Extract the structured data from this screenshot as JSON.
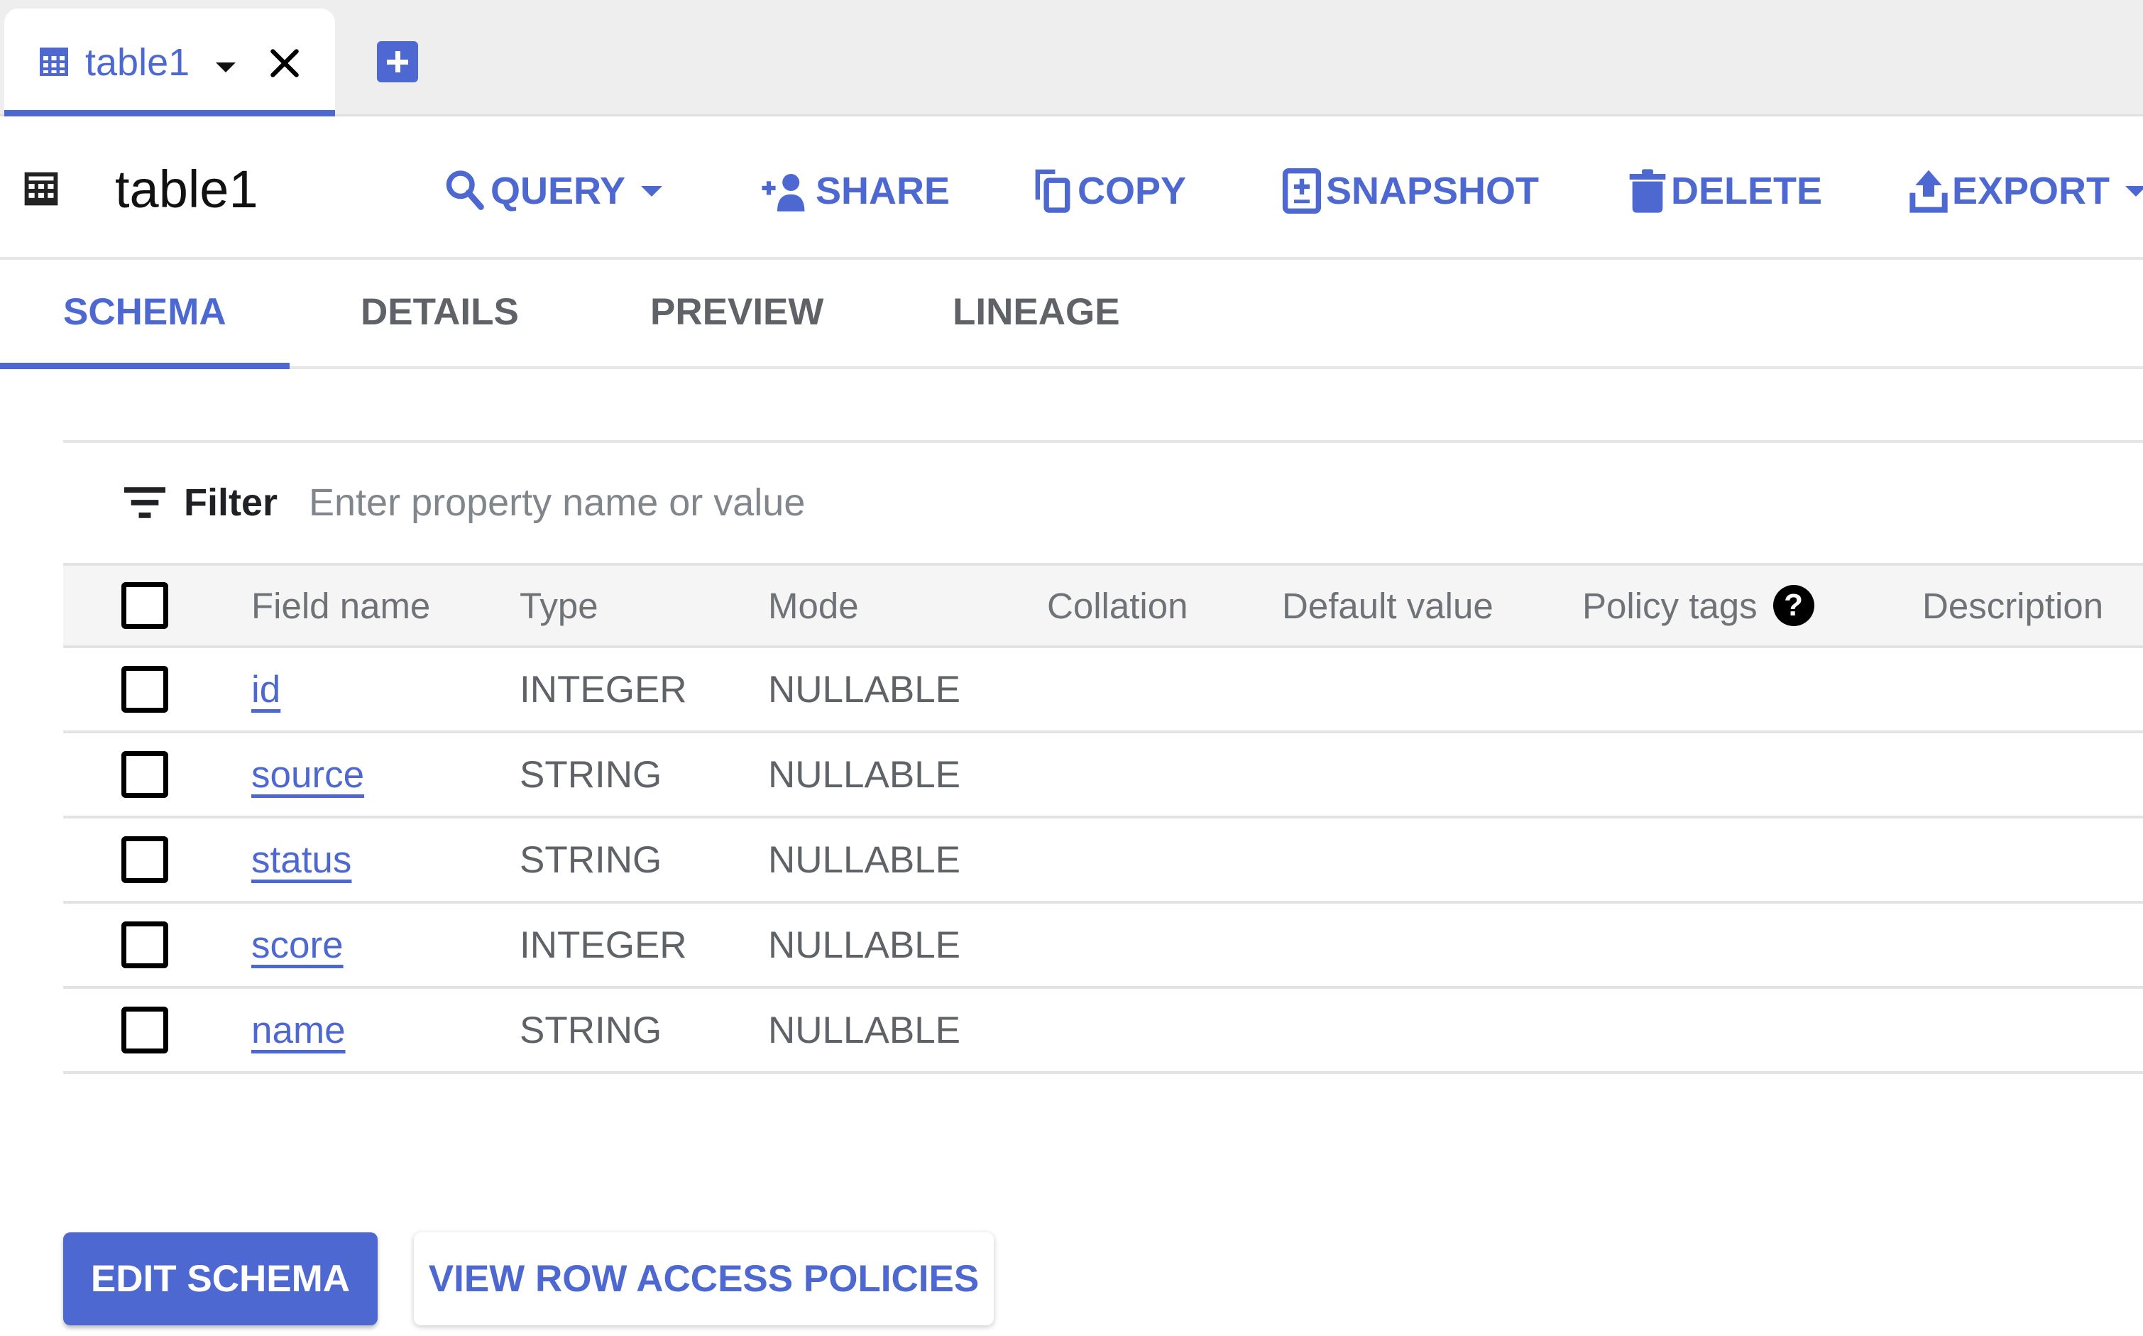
{
  "tab_strip": {
    "tabs": [
      {
        "label": "table1",
        "icon": "table-icon",
        "active": true
      }
    ],
    "add_tab_icon": "add-box-icon"
  },
  "toolbar": {
    "title": "table1",
    "title_icon": "table-icon",
    "buttons": [
      {
        "label": "QUERY",
        "icon": "search-icon",
        "has_dropdown": true
      },
      {
        "label": "SHARE",
        "icon": "person-add-icon",
        "has_dropdown": false
      },
      {
        "label": "COPY",
        "icon": "copy-icon",
        "has_dropdown": false
      },
      {
        "label": "SNAPSHOT",
        "icon": "snapshot-icon",
        "has_dropdown": false
      },
      {
        "label": "DELETE",
        "icon": "trash-icon",
        "has_dropdown": false
      },
      {
        "label": "EXPORT",
        "icon": "upload-icon",
        "has_dropdown": true
      }
    ]
  },
  "section_tabs": [
    {
      "label": "SCHEMA",
      "active": true
    },
    {
      "label": "DETAILS",
      "active": false
    },
    {
      "label": "PREVIEW",
      "active": false
    },
    {
      "label": "LINEAGE",
      "active": false
    }
  ],
  "filter": {
    "label": "Filter",
    "placeholder": "Enter property name or value",
    "value": ""
  },
  "schema": {
    "columns": [
      "Field name",
      "Type",
      "Mode",
      "Collation",
      "Default value",
      "Policy tags",
      "Description"
    ],
    "policy_help": "?",
    "rows": [
      {
        "field": "id",
        "type": "INTEGER",
        "mode": "NULLABLE",
        "collation": "",
        "default": "",
        "policy_tags": "",
        "description": ""
      },
      {
        "field": "source",
        "type": "STRING",
        "mode": "NULLABLE",
        "collation": "",
        "default": "",
        "policy_tags": "",
        "description": ""
      },
      {
        "field": "status",
        "type": "STRING",
        "mode": "NULLABLE",
        "collation": "",
        "default": "",
        "policy_tags": "",
        "description": ""
      },
      {
        "field": "score",
        "type": "INTEGER",
        "mode": "NULLABLE",
        "collation": "",
        "default": "",
        "policy_tags": "",
        "description": ""
      },
      {
        "field": "name",
        "type": "STRING",
        "mode": "NULLABLE",
        "collation": "",
        "default": "",
        "policy_tags": "",
        "description": ""
      }
    ]
  },
  "actions": {
    "edit_schema": "EDIT SCHEMA",
    "view_row_access": "VIEW ROW ACCESS POLICIES"
  },
  "colors": {
    "accent": "#4d69d1",
    "text_secondary": "#5f6368",
    "header_bg": "#f5f5f5",
    "tabstrip_bg": "#eeeeee"
  }
}
